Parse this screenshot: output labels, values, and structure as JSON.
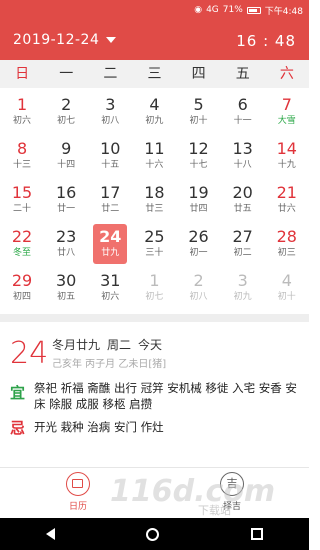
{
  "status": {
    "battery": "71%",
    "time": "下午4:48",
    "signal": "4G"
  },
  "header": {
    "date": "2019-12-24",
    "clock": "16 : 48"
  },
  "weekdays": [
    "日",
    "一",
    "二",
    "三",
    "四",
    "五",
    "六"
  ],
  "calendar": [
    [
      {
        "d": "1",
        "l": "初六"
      },
      {
        "d": "2",
        "l": "初七"
      },
      {
        "d": "3",
        "l": "初八"
      },
      {
        "d": "4",
        "l": "初九"
      },
      {
        "d": "5",
        "l": "初十"
      },
      {
        "d": "6",
        "l": "十一"
      },
      {
        "d": "7",
        "l": "大雪"
      }
    ],
    [
      {
        "d": "8",
        "l": "十三"
      },
      {
        "d": "9",
        "l": "十四"
      },
      {
        "d": "10",
        "l": "十五"
      },
      {
        "d": "11",
        "l": "十六"
      },
      {
        "d": "12",
        "l": "十七"
      },
      {
        "d": "13",
        "l": "十八"
      },
      {
        "d": "14",
        "l": "十九"
      }
    ],
    [
      {
        "d": "15",
        "l": "二十"
      },
      {
        "d": "16",
        "l": "廿一"
      },
      {
        "d": "17",
        "l": "廿二"
      },
      {
        "d": "18",
        "l": "廿三"
      },
      {
        "d": "19",
        "l": "廿四"
      },
      {
        "d": "20",
        "l": "廿五"
      },
      {
        "d": "21",
        "l": "廿六"
      }
    ],
    [
      {
        "d": "22",
        "l": "冬至"
      },
      {
        "d": "23",
        "l": "廿八"
      },
      {
        "d": "24",
        "l": "廿九"
      },
      {
        "d": "25",
        "l": "三十"
      },
      {
        "d": "26",
        "l": "初一"
      },
      {
        "d": "27",
        "l": "初二"
      },
      {
        "d": "28",
        "l": "初三"
      }
    ],
    [
      {
        "d": "29",
        "l": "初四"
      },
      {
        "d": "30",
        "l": "初五"
      },
      {
        "d": "31",
        "l": "初六"
      },
      {
        "d": "1",
        "l": "初七"
      },
      {
        "d": "2",
        "l": "初八"
      },
      {
        "d": "3",
        "l": "初九"
      },
      {
        "d": "4",
        "l": "初十"
      }
    ]
  ],
  "detail": {
    "day": "24",
    "lunar": "冬月廿九",
    "weekday": "周二",
    "today": "今天",
    "ganzhi": "己亥年 丙子月 乙未日[猪]",
    "yi_label": "宜",
    "yi": "祭祀 祈福 斋醮 出行 冠笄 安机械 移徙 入宅 安香 安床 除服 成服 移柩 启攒",
    "ji_label": "忌",
    "ji": "开光 栽种 治病 安门 作灶"
  },
  "tabs": {
    "calendar": "日历",
    "almanac": "择吉",
    "almanac_icon": "吉"
  },
  "watermark": {
    "main": "116d.com",
    "sub": "下载站"
  }
}
